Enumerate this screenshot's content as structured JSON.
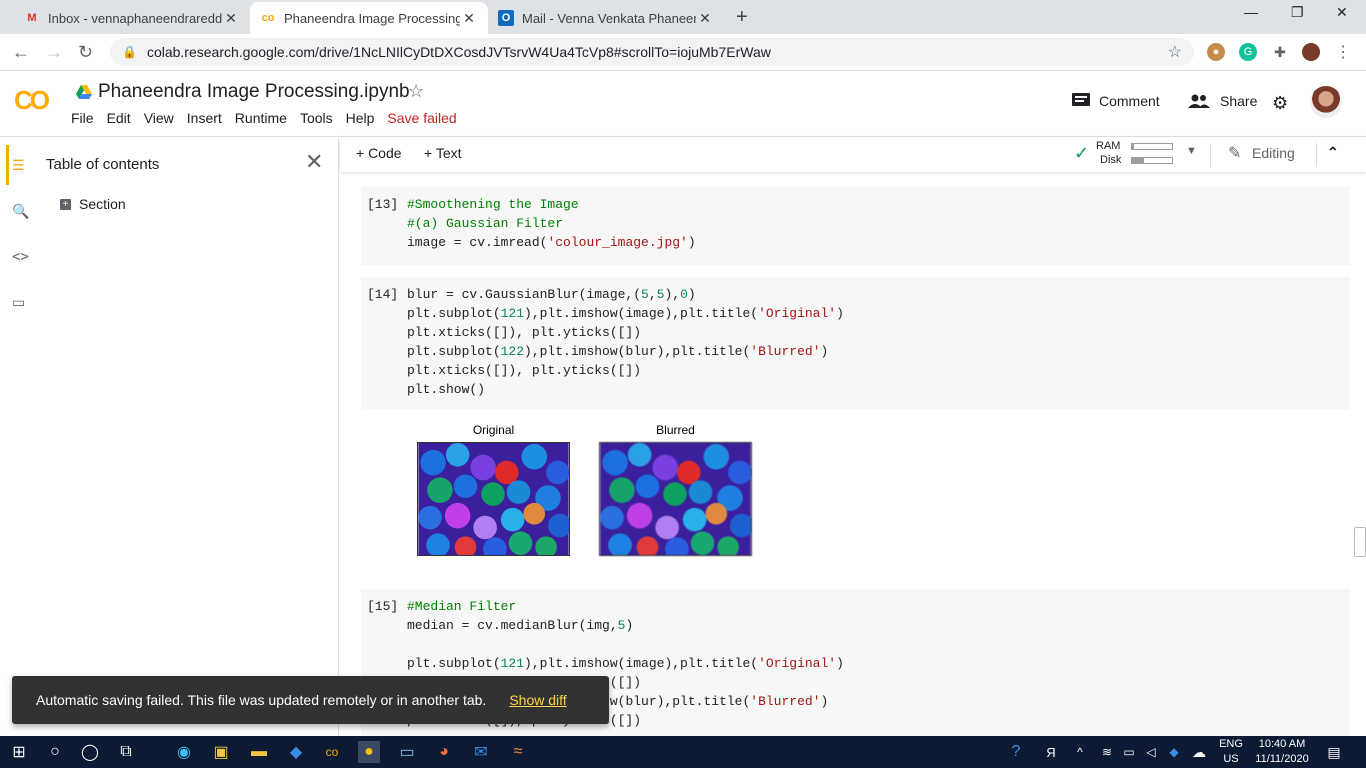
{
  "browser": {
    "tabs": [
      {
        "title": "Inbox - vennaphaneendrareddy@",
        "icon": "gmail-icon"
      },
      {
        "title": "Phaneendra Image Processing.ip",
        "icon": "colab-icon"
      },
      {
        "title": "Mail - Venna Venkata Phaneendr",
        "icon": "outlook-icon"
      }
    ],
    "url": "colab.research.google.com/drive/1NcLNIlCyDtDXCosdJVTsrvW4Ua4TcVp8#scrollTo=iojuMb7ErWaw",
    "minimize_symbol": "—",
    "restore_symbol": "❐",
    "close_symbol": "✕"
  },
  "colab": {
    "logo_text": "CO",
    "notebook_title": "Phaneendra Image Processing.ipynb",
    "menu": [
      "File",
      "Edit",
      "View",
      "Insert",
      "Runtime",
      "Tools",
      "Help"
    ],
    "save_status": "Save failed",
    "comment_label": "Comment",
    "share_label": "Share",
    "toolbar": {
      "code_label": "+ Code",
      "text_label": "+ Text",
      "ram_label": "RAM",
      "disk_label": "Disk",
      "ram_fill": 0.05,
      "disk_fill": 0.3,
      "editing_label": "Editing"
    }
  },
  "sidebar": {
    "title": "Table of contents",
    "items": [
      {
        "label": "Section"
      }
    ]
  },
  "cells": [
    {
      "number": "[13]"
    },
    {
      "number": "[14]"
    },
    {
      "number": "[15]"
    }
  ],
  "output": {
    "titles": [
      "Original",
      "Blurred"
    ]
  },
  "toast": {
    "message": "Automatic saving failed. This file was updated remotely or in another tab.",
    "action": "Show diff"
  },
  "taskbar": {
    "lang": "ENG",
    "region": "US",
    "time": "10:40 AM",
    "date": "11/11/2020"
  },
  "colors": {
    "accent": "#f9ab00",
    "error": "#c5221f",
    "comment": "#008000",
    "string": "#a31515",
    "number": "#098658",
    "toast_bg": "#323232",
    "toast_action": "#ffd54f"
  }
}
